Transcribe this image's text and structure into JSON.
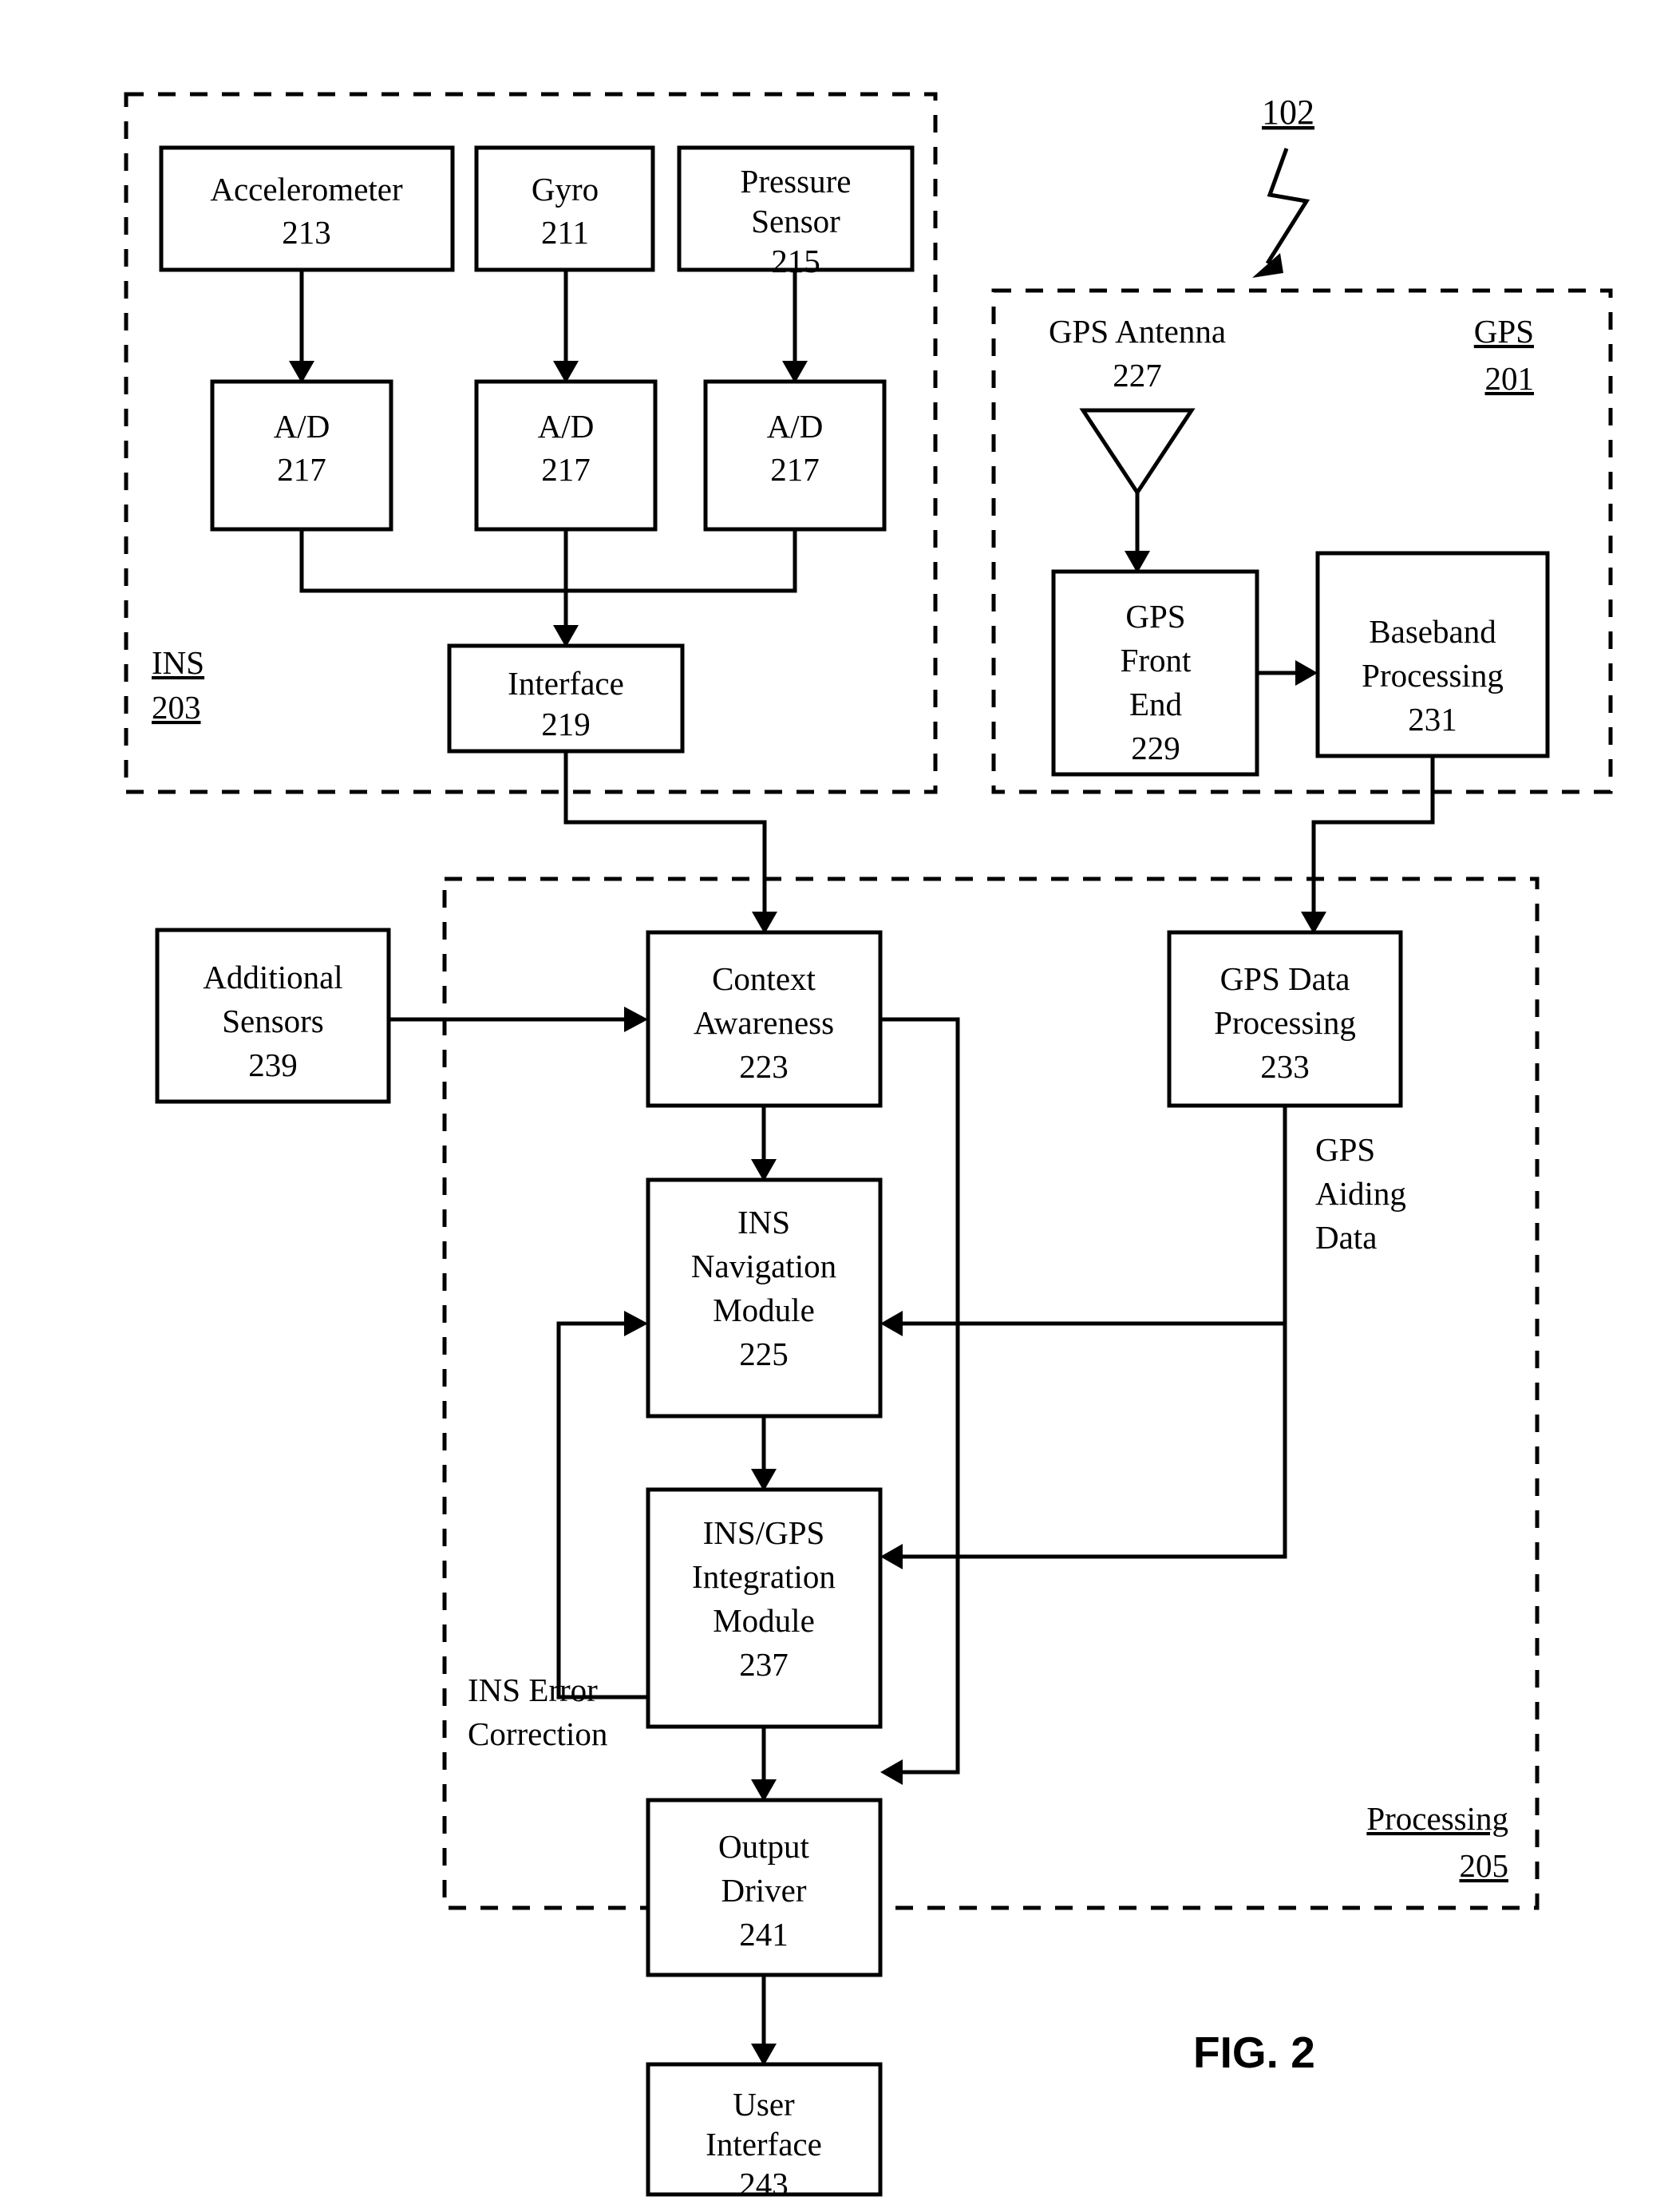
{
  "figure": {
    "caption": "FIG. 2",
    "reference_numeral": "102"
  },
  "sections": [
    {
      "id": "ins",
      "name": "INS",
      "numeral": "203"
    },
    {
      "id": "gps",
      "name": "GPS",
      "numeral": "201"
    },
    {
      "id": "processing",
      "name": "Processing",
      "numeral": "205"
    }
  ],
  "blocks": {
    "accelerometer": {
      "lines": [
        "Accelerometer"
      ],
      "numeral": "213"
    },
    "gyro": {
      "lines": [
        "Gyro"
      ],
      "numeral": "211"
    },
    "pressure_sensor": {
      "lines": [
        "Pressure",
        "Sensor"
      ],
      "numeral": "215"
    },
    "ad1": {
      "lines": [
        "A/D"
      ],
      "numeral": "217"
    },
    "ad2": {
      "lines": [
        "A/D"
      ],
      "numeral": "217"
    },
    "ad3": {
      "lines": [
        "A/D"
      ],
      "numeral": "217"
    },
    "interface": {
      "lines": [
        "Interface"
      ],
      "numeral": "219"
    },
    "gps_antenna": {
      "lines": [
        "GPS Antenna"
      ],
      "numeral": "227"
    },
    "gps_front_end": {
      "lines": [
        "GPS",
        "Front",
        "End"
      ],
      "numeral": "229"
    },
    "baseband": {
      "lines": [
        "Baseband",
        "Processing"
      ],
      "numeral": "231"
    },
    "additional_sensors": {
      "lines": [
        "Additional",
        "Sensors"
      ],
      "numeral": "239"
    },
    "context_awareness": {
      "lines": [
        "Context",
        "Awareness"
      ],
      "numeral": "223"
    },
    "gps_data_processing": {
      "lines": [
        "GPS Data",
        "Processing"
      ],
      "numeral": "233"
    },
    "ins_nav_module": {
      "lines": [
        "INS",
        "Navigation",
        "Module"
      ],
      "numeral": "225"
    },
    "ins_gps_integration": {
      "lines": [
        "INS/GPS",
        "Integration",
        "Module"
      ],
      "numeral": "237"
    },
    "output_driver": {
      "lines": [
        "Output",
        "Driver"
      ],
      "numeral": "241"
    },
    "user_interface": {
      "lines": [
        "User",
        "Interface"
      ],
      "numeral": "243"
    }
  },
  "wire_labels": {
    "gps_aiding_data": [
      "GPS",
      "Aiding",
      "Data"
    ],
    "ins_error_correction": [
      "INS Error",
      "Correction"
    ]
  },
  "colors": {
    "line": "#000000",
    "fill": "#ffffff",
    "background": "#ffffff"
  }
}
